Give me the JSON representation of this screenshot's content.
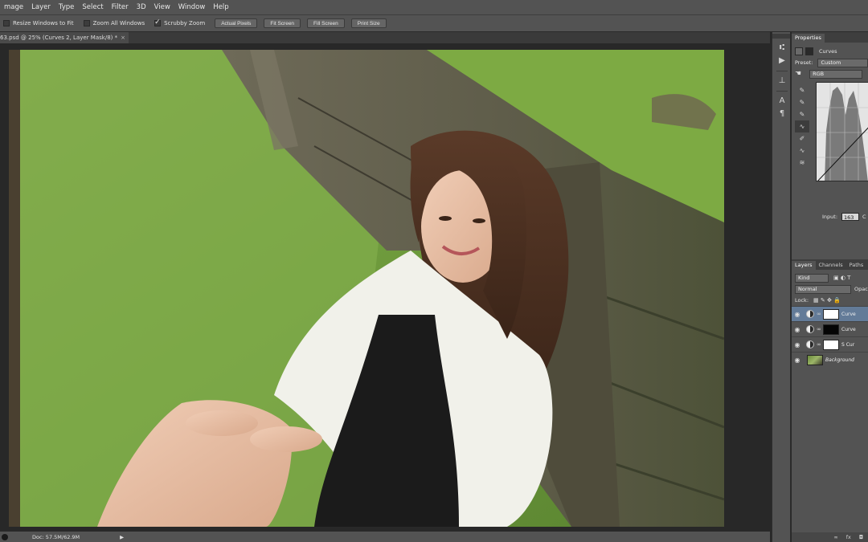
{
  "menubar": {
    "items": [
      "mage",
      "Layer",
      "Type",
      "Select",
      "Filter",
      "3D",
      "View",
      "Window",
      "Help"
    ]
  },
  "options_bar": {
    "resize_windows": {
      "label": "Resize Windows to Fit",
      "checked": false
    },
    "zoom_all_windows": {
      "label": "Zoom All Windows",
      "checked": false
    },
    "scrubby_zoom": {
      "label": "Scrubby Zoom",
      "checked": true
    },
    "buttons": [
      "Actual Pixels",
      "Fit Screen",
      "Fill Screen",
      "Print Size"
    ]
  },
  "document": {
    "tab_title": "63.psd @ 25% (Curves 2, Layer Mask/8) *",
    "close_glyph": "×"
  },
  "status": {
    "doc_size": "Doc: 57.5M/62.9M",
    "arrow": "▶"
  },
  "properties": {
    "tab": "Properties",
    "panel_title": "Curves",
    "preset_label": "Preset:",
    "preset_value": "Custom",
    "channel_value": "RGB",
    "input_label": "Input:",
    "input_value": "163",
    "output_partial": "C"
  },
  "layers_panel": {
    "tabs": [
      "Layers",
      "Channels",
      "Paths"
    ],
    "kind_label": "Kind",
    "blend_mode": "Normal",
    "opacity_partial": "Opac",
    "lock_label": "Lock:",
    "layers": [
      {
        "name": "Curve",
        "mask": "white",
        "selected": true
      },
      {
        "name": "Curve",
        "mask": "black",
        "selected": false
      },
      {
        "name": "S Cur",
        "mask": "white",
        "selected": false
      },
      {
        "name": "Background",
        "mask": "photo",
        "selected": false
      }
    ],
    "bottom_icons": [
      "link-icon",
      "fx-icon",
      "mask-icon"
    ]
  },
  "colors": {
    "chrome": "#535353",
    "dark": "#282828",
    "selected_layer": "#637b98"
  }
}
